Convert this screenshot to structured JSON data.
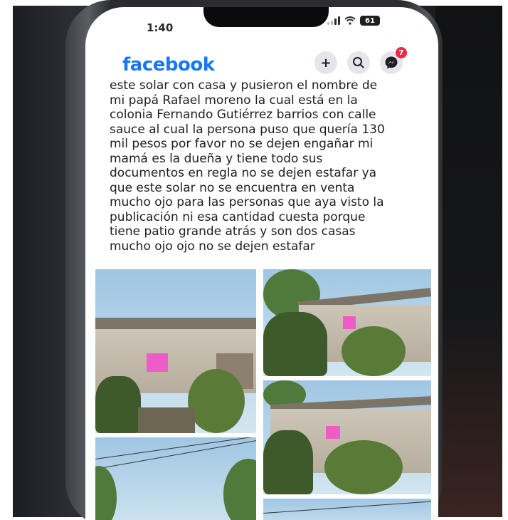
{
  "status_bar": {
    "time": "1:40",
    "battery": "61"
  },
  "header": {
    "logo": "facebook",
    "add_icon": "+",
    "search_icon": "search-icon",
    "messenger_icon": "messenger-icon",
    "messenger_badge": "7"
  },
  "post": {
    "lines": [
      "este solar con casa y pusieron el nombre de",
      "mi papá Rafael moreno la cual está  en la",
      "colonia Fernando Gutiérrez barrios con calle",
      "sauce al cual la persona puso que quería 130",
      "mil pesos por favor no se dejen engañar mi",
      "mamá es la dueña y tiene todo sus",
      "documentos en regla no se dejen estafar ya",
      "que este solar no se encuentra en venta",
      "mucho ojo para las personas que aya visto la",
      "publicación ni esa cantidad cuesta porque",
      "tiene patio grande atrás y son dos casas",
      "mucho ojo ojo no se dejen estafar"
    ]
  },
  "colors": {
    "facebook_blue": "#1877f2",
    "badge_red": "#f02849",
    "pink_sign": "#ee5cc7"
  }
}
